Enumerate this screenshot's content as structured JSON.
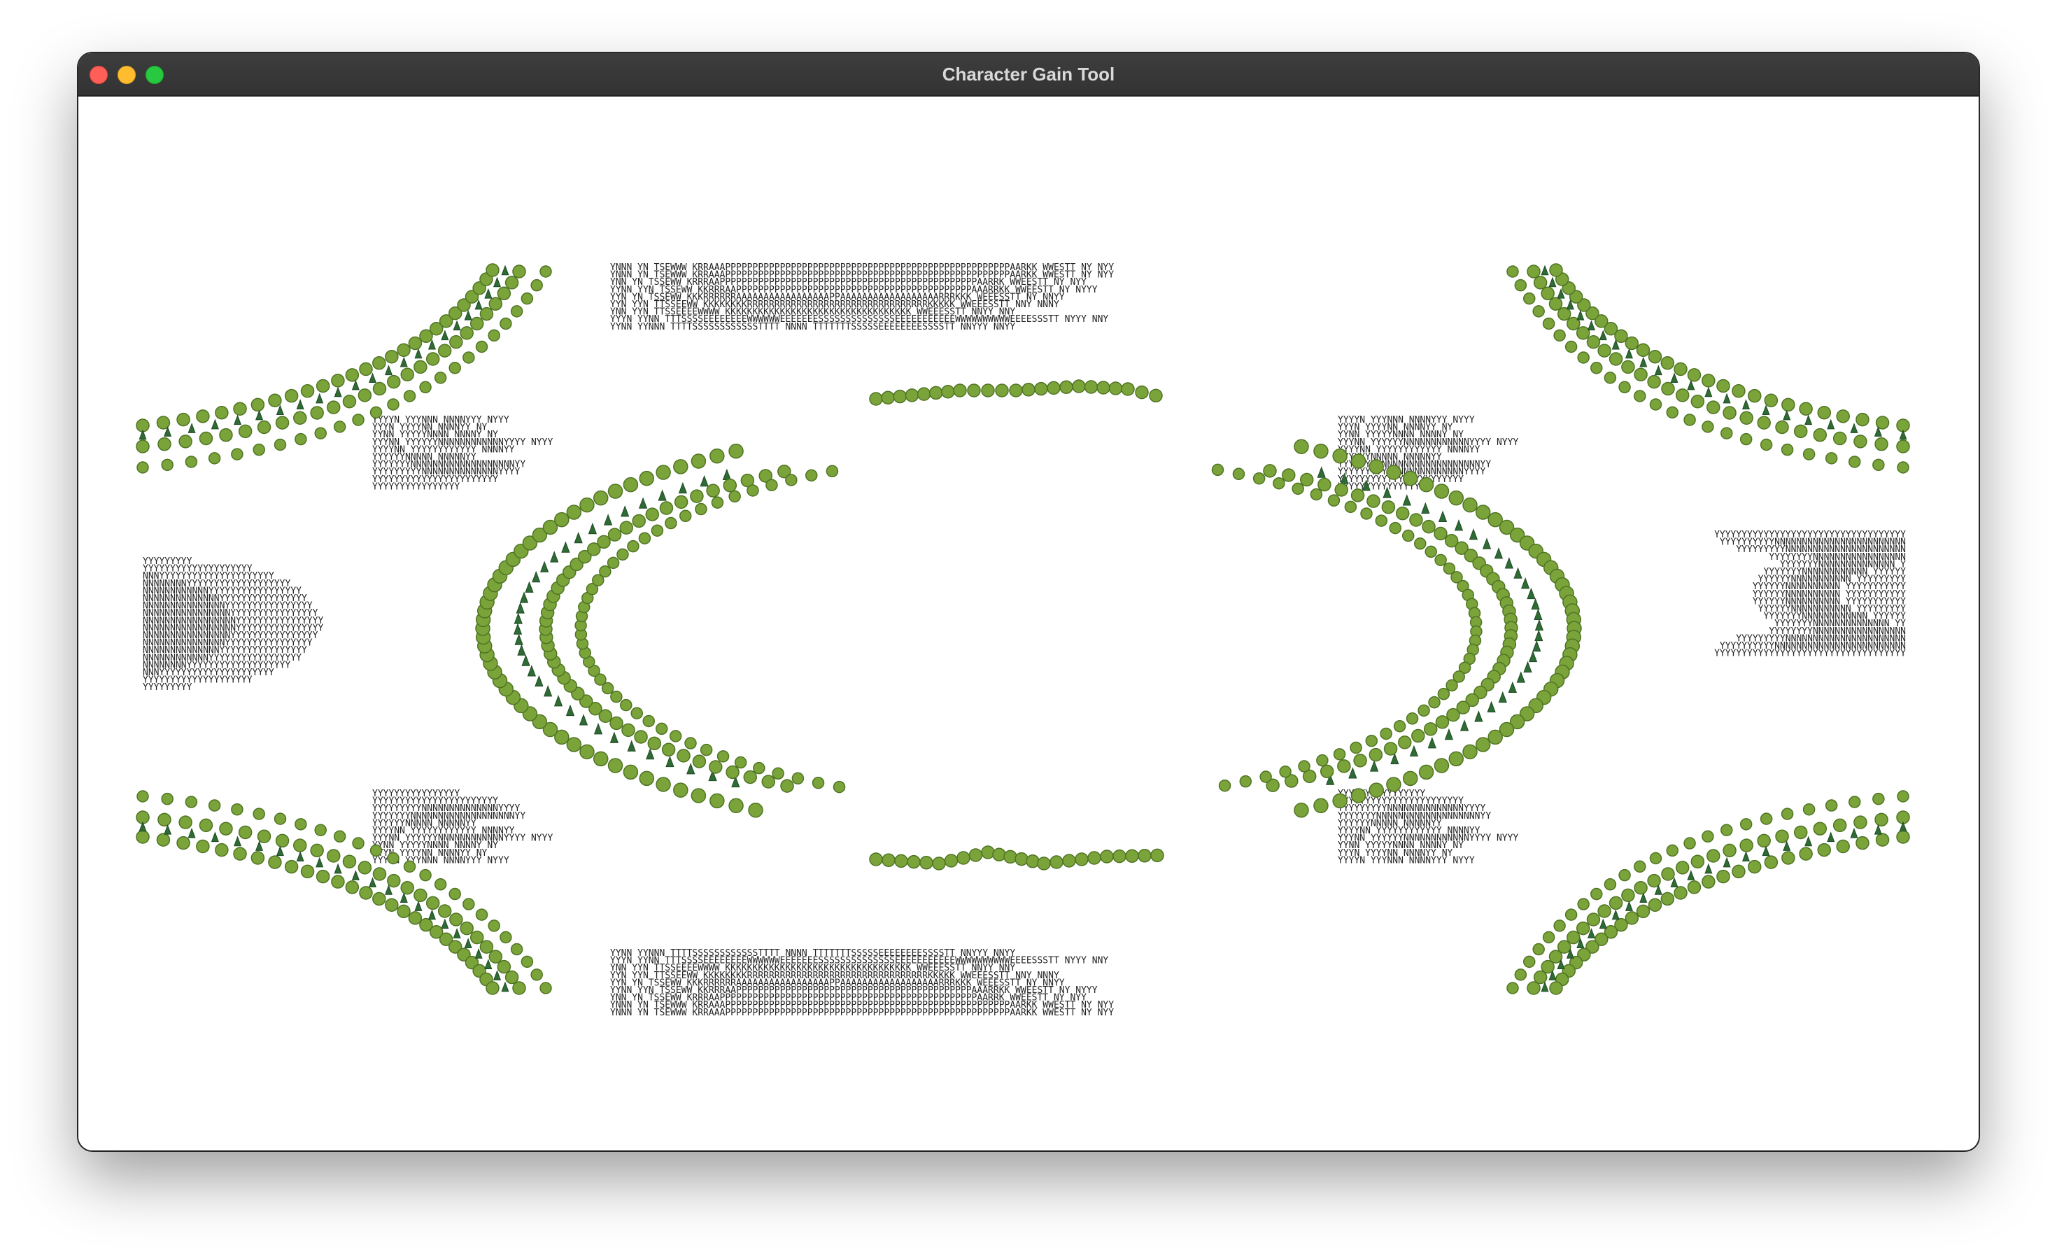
{
  "window": {
    "title": "Character Gain Tool"
  },
  "colors": {
    "tree_round": "#7aa43a",
    "tree_round_dark": "#4f7423",
    "tree_pine": "#2f6b35",
    "text": "#222222"
  },
  "map_rows": {
    "top_center": [
      "YNNN  YN   TSEWWW  KRRAAAPPPPPPPPPPPPPPPPPPPPPPPPPPPPPPPPPPPPPPPPPPPPPPPPPPPPAARKK  WWESTT   NY  NYY",
      "YNNN  YN   TSEWWW  KRRAAAPPPPPPPPPPPPPPPPPPPPPPPPPPPPPPPPPPPPPPPPPPPPPPPPPPPPAARKK  WWESTT   NY  NYY",
      "YNN  YN    TSSEWW   KRRRAAPPPPPPPPPPPPPPPPPPPPPPPPPPPPPPPPPPPPPPPPPPPPPPPAARRK   WWEESTT   NY  NYY",
      "YYNN  YYN    TSSEWW   KKRRRAAPPPPPPPPPPPPPPPPPPPPPPPPPPPPPPPPPPPPPPPPPPPAAARRKK  WWEESTT   NY NYYY",
      "YYN   YN    TSSEWW    KKKRRRRRRAAAAAAAAAAAAAAAAAPPAAAAAAAAAAAAAAAAAARRRKKK   WEEESSTT  NY  NNYY",
      "YYN   YYN    TTSSEEWW     KKKKKKKKRRRRRRRRRRRRRRRRRRRRRRRRRRRRRRRRRKKKKK    WWEEESSTT  NNY  NNNY",
      "YNN    YYN   TTSSEEEEWWWW        KKKKKKKKKKKKKKKKKKKKKKKKKKKKKKKKKK       WWEEESSTT  NNYY  NNY",
      "YYYN    YYNN   TTTSSSSEEEEEEEEWWWWWWEEEEEEESSSSSSSSSSSSSSEEEEEEEEEEEWWWWWWWWWWEEEESSSTT   NYYY  NNY",
      "YYNN   YYNNN   TTTTSSSSSSSSSSSSTTTT         NNNN       TTTTTTTSSSSSEEEEEEEESSSSTT  NNYYY   NNYY"
    ],
    "left_block": [
      "YYYYYYYYY",
      "YYYYYYYYYYYYYYYYYYYY",
      "NNNYYYYYYYYYYYYYYYYYYYYY",
      "NNNNNNNNYYYYYYYYYYYYYYYYYYY",
      "NNNNNNNNNNNNYYYYYYYYYYYYYYYYY",
      "NNNNNNNNNNNNNNYYYYYYYYYYYYYYYY",
      "NNNNNNNNNNNNNNNYYYYYYYYYYYYYYYY",
      "NNNNNNNNNNNNNNNNYYYYYYYYYYYYYYYY",
      "NNNNNNNNNNNNNNNNNYYYYYYYYYYYYYYYY",
      "NNNNNNNNNNNNNNNNNYYYYYYYYYYYYYYYY",
      "NNNNNNNNNNNNNNNNYYYYYYYYYYYYYYYY",
      "NNNNNNNNNNNNNNNYYYYYYYYYYYYYYYY",
      "NNNNNNNNNNNNNNYYYYYYYYYYYYYYYY",
      "NNNNNNNNNNNNYYYYYYYYYYYYYYYYY",
      "NNNNNNNNYYYYYYYYYYYYYYYYYYY",
      "NNNYYYYYYYYYYYYYYYYYYYYY",
      "YYYYYYYYYYYYYYYYYYYY",
      "YYYYYYYYY"
    ],
    "right_block": [
      "YYYYYYYYYYYYYYYYYYYYYYYYYYYYYYYYYYY",
      "YYYYYYYYYYNNNNNNNNNNNNNNNNNNNNNNNN",
      "YYYYYYYYYNNNNNNNNNNNNNNNNNNNNNN",
      "YYYYYYYYNNNNNNNNNNNNNNNNN",
      "YYYYYYYNNNNNNNNNNNNNN         Y",
      "YYYYYYYNNNNNNNNNNNN       YYYYYY",
      "YYYYYYNNNNNNNNNNN      YYYYYYYYY",
      "YYYYYYNNNNNNNNNN     YYYYYYYYYYY",
      "YYYYYYNNNNNNNNNN     YYYYYYYYYYY",
      "YYYYYYNNNNNNNNNN     YYYYYYYYYYY",
      "YYYYYYNNNNNNNNNNN      YYYYYYYYY",
      "YYYYYYYNNNNNNNNNNNN       YYYYYY",
      "YYYYYYYNNNNNNNNNNNNNN         YY",
      "YYYYYYYYNNNNNNNNNNNNNNNNN",
      "YYYYYYYYYNNNNNNNNNNNNNNNNNNNNNN",
      "YYYYYYYYYYNNNNNNNNNNNNNNNNNNNNNNNN",
      "YYYYYYYYYYYYYYYYYYYYYYYYYYYYYYYYYYY"
    ],
    "left_side": [
      "YYYYN   YYYNNN         NNNNYYY  NYYY",
      "YYYN    YYYYNN        NNNNYY   NY",
      "YYNN   YYYYYNNNN        NNNNY  NY",
      "YYYNN   YYYYYYNNNNNNNNNNNNYYYY  NYYY",
      "YYYYNN   YYYYYYYYYYYY    NNNNYY",
      "YYYYYYNNNNN           NNNNNYY",
      "YYYYYYYNNNNNNNNNNNNNNNNNNNYY",
      "YYYYYYYYYNNNNNNNNNNNNNNYYYY",
      "YYYYYYYYYYYYYYYYYYYYYYY",
      "YYYYYYYYYYYYYYYY"
    ]
  }
}
